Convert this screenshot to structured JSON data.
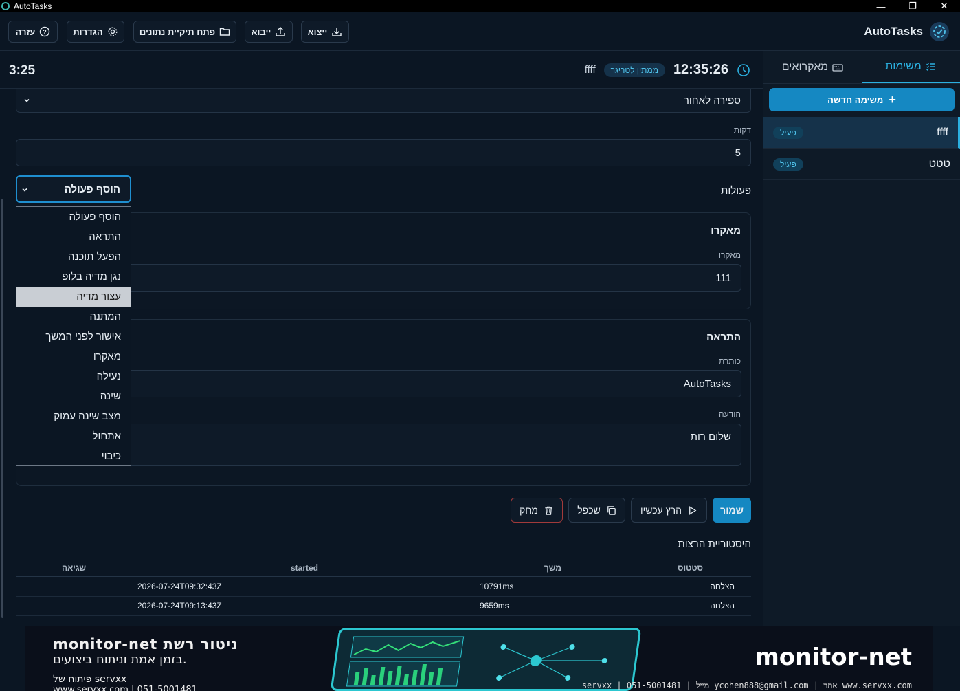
{
  "window": {
    "title": "AutoTasks",
    "minimize": "—",
    "restore": "❐",
    "close": "✕"
  },
  "toolbar": {
    "help_label": "עזרה",
    "settings_label": "הגדרות",
    "open_folder_label": "פתח תיקיית נתונים",
    "import_label": "ייבוא",
    "export_label": "ייצוא",
    "brand": "AutoTasks"
  },
  "sidebar": {
    "tabs": [
      {
        "label": "משימות"
      },
      {
        "label": "מאקרואים"
      }
    ],
    "new_task_label": "משימה חדשה",
    "tasks": [
      {
        "name": "ffff",
        "status": "פעיל"
      },
      {
        "name": "טטט",
        "status": "פעיל"
      }
    ]
  },
  "header": {
    "countdown": "3:25",
    "clock": "12:35:26",
    "status": "ממתין לטריגר",
    "task_name": "ffff"
  },
  "form": {
    "trigger_type": "ספירה לאחור",
    "minutes_label": "דקות",
    "minutes_value": "5",
    "actions_label": "פעולות",
    "add_action_label": "הוסף פעולה",
    "macro_section_title": "מאקרו",
    "macro_label": "מאקרו",
    "macro_value": "111",
    "notify_section_title": "התראה",
    "notify_title_label": "כותרת",
    "notify_title_value": "AutoTasks",
    "notify_message_label": "הודעה",
    "notify_message_value": "שלום רות"
  },
  "dropdown": {
    "items": [
      "הוסף פעולה",
      "התראה",
      "הפעל תוכנה",
      "נגן מדיה בלופ",
      "עצור מדיה",
      "המתנה",
      "אישור לפני המשך",
      "מאקרו",
      "נעילה",
      "שינה",
      "מצב שינה עמוק",
      "אתחול",
      "כיבוי"
    ],
    "highlighted": "עצור מדיה"
  },
  "buttons": {
    "save": "שמור",
    "run_now": "הרץ עכשיו",
    "duplicate": "שכפל",
    "delete": "מחק"
  },
  "history": {
    "title": "היסטוריית הרצות",
    "columns": {
      "status": "סטטוס",
      "duration": "משך",
      "started": "started",
      "error": "שגיאה"
    },
    "rows": [
      {
        "status": "הצלחה",
        "duration": "10791ms",
        "started": "2026-07-24T09:32:43Z",
        "error": ""
      },
      {
        "status": "הצלחה",
        "duration": "9659ms",
        "started": "2026-07-24T09:13:43Z",
        "error": ""
      }
    ]
  },
  "banner": {
    "line1": "monitor-net ניטור רשת",
    "line2": "בזמן אמת וניתוח ביצועים.",
    "line3": "פיתוח של servxx",
    "line4": "www.servxx.com | 051-5001481",
    "brand": "monitor-net",
    "footer": "servxx | 051-5001481 | מייל ycohen888@gmail.com | אתר www.servxx.com"
  },
  "colors": {
    "accent": "#1588c2",
    "background": "#0b1623",
    "danger": "#e05555"
  }
}
